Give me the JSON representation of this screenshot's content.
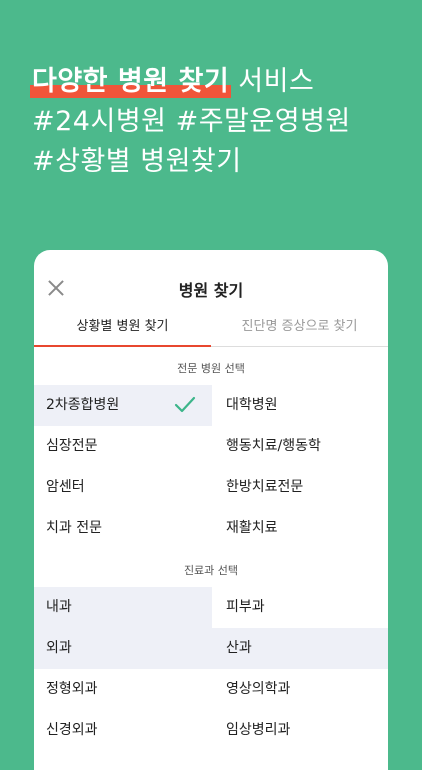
{
  "headline": {
    "highlight": "다양한 병원 찾기",
    "line1_rest": " 서비스",
    "line2": "#24시병원 #주말운영병원",
    "line3": "#상황별 병원찾기"
  },
  "sheet": {
    "title": "병원 찾기",
    "tabs": [
      {
        "label": "상황별 병원 찾기",
        "active": true
      },
      {
        "label": "진단명 증상으로 찾기",
        "active": false
      }
    ],
    "section1": {
      "label": "전문 병원 선택",
      "items": [
        {
          "label": "2차종합병원",
          "selected": true
        },
        {
          "label": "대학병원",
          "selected": false
        },
        {
          "label": "심장전문",
          "selected": false
        },
        {
          "label": "행동치료/행동학",
          "selected": false
        },
        {
          "label": "암센터",
          "selected": false
        },
        {
          "label": "한방치료전문",
          "selected": false
        },
        {
          "label": "치과 전문",
          "selected": false
        },
        {
          "label": "재활치료",
          "selected": false
        }
      ]
    },
    "section2": {
      "label": "진료과 선택",
      "items": [
        {
          "label": "내과",
          "selected": true
        },
        {
          "label": "피부과",
          "selected": false
        },
        {
          "label": "외과",
          "selected": true
        },
        {
          "label": "산과",
          "selected": true
        },
        {
          "label": "정형외과",
          "selected": false
        },
        {
          "label": "영상의학과",
          "selected": false
        },
        {
          "label": "신경외과",
          "selected": false
        },
        {
          "label": "임상병리과",
          "selected": false
        }
      ]
    }
  },
  "colors": {
    "background": "#4cb98c",
    "highlight": "#f0553a",
    "accent_tab": "#e8472f",
    "check": "#3cb58a",
    "selected_bg": "#eef0f7"
  },
  "icons": {
    "close": "close-icon",
    "check": "check-icon"
  }
}
